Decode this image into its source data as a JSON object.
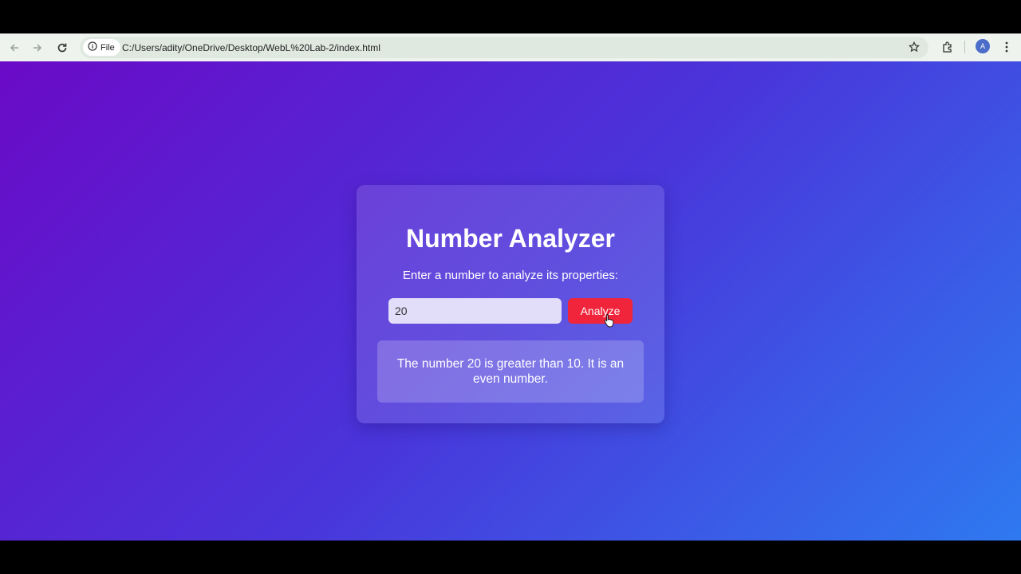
{
  "browser": {
    "site_chip_label": "File",
    "url": "C:/Users/adity/OneDrive/Desktop/WebL%20Lab-2/index.html",
    "profile_initial": "A",
    "icons": {
      "back": "back-arrow-icon",
      "forward": "forward-arrow-icon",
      "reload": "reload-icon",
      "info": "info-icon",
      "bookmark": "star-icon",
      "extensions": "puzzle-icon",
      "menu": "kebab-menu-icon"
    }
  },
  "page": {
    "title": "Number Analyzer",
    "subtitle": "Enter a number to analyze its properties:",
    "input_value": "20",
    "button_label": "Analyze",
    "result": "The number 20 is greater than 10. It is an even number."
  },
  "colors": {
    "gradient_start": "#6a0ac7",
    "gradient_end": "#2e79f0",
    "button": "#f0243a"
  }
}
